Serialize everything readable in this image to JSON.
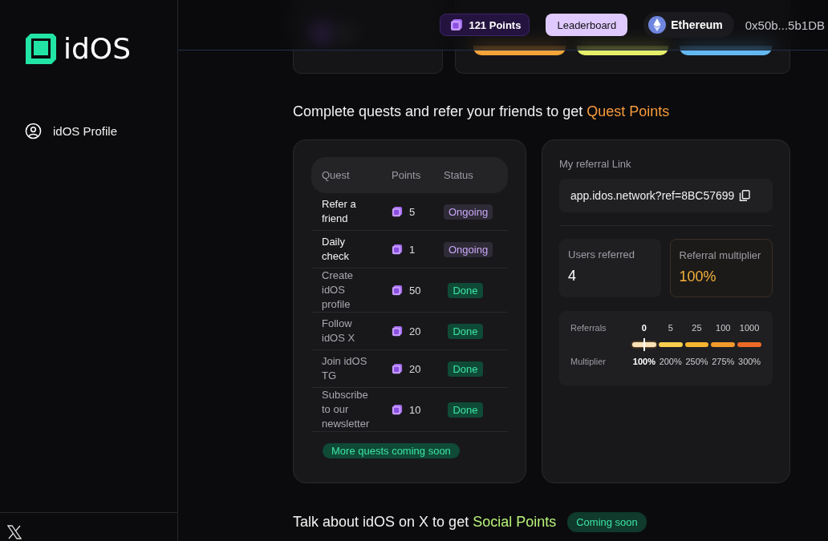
{
  "sidebar": {
    "logo": "idOS",
    "items": [
      {
        "label": "idOS Profile"
      }
    ]
  },
  "header": {
    "points": "121 Points",
    "leaderboard": "Leaderboard",
    "network": "Ethereum",
    "address": "0x50b...5b1DB"
  },
  "quests_section": {
    "heading": "Complete quests and refer your friends to get ",
    "highlight": "Quest Points",
    "columns": [
      "Quest",
      "Points",
      "Status"
    ],
    "rows": [
      {
        "name": "Refer a friend",
        "points": "5",
        "status": "Ongoing",
        "kind": "ongoing"
      },
      {
        "name": "Daily check",
        "points": "1",
        "status": "Ongoing",
        "kind": "ongoing"
      },
      {
        "name": "Create idOS profile",
        "points": "50",
        "status": "Done",
        "kind": "done"
      },
      {
        "name": "Follow idOS X",
        "points": "20",
        "status": "Done",
        "kind": "done"
      },
      {
        "name": "Join idOS TG",
        "points": "20",
        "status": "Done",
        "kind": "done"
      },
      {
        "name": "Subscribe to our newsletter",
        "points": "10",
        "status": "Done",
        "kind": "done"
      }
    ],
    "more": "More quests coming soon"
  },
  "referral": {
    "link_label": "My referral Link",
    "link": "app.idos.network?ref=8BC57699",
    "users_label": "Users referred",
    "users_value": "4",
    "multiplier_label": "Referral multiplier",
    "multiplier_value": "100%",
    "referrals_label": "Referrals",
    "multiplier_row_label": "Multiplier",
    "tiers": [
      {
        "referrals": "0",
        "multiplier": "100%",
        "color": "#fde2b8",
        "selected": true
      },
      {
        "referrals": "5",
        "multiplier": "200%",
        "color": "#fbcf4d",
        "selected": false
      },
      {
        "referrals": "25",
        "multiplier": "250%",
        "color": "#f8b531",
        "selected": false
      },
      {
        "referrals": "100",
        "multiplier": "275%",
        "color": "#f39a2c",
        "selected": false
      },
      {
        "referrals": "1000",
        "multiplier": "300%",
        "color": "#ec6a26",
        "selected": false
      }
    ]
  },
  "social_section": {
    "heading": "Talk about idOS on X to get ",
    "highlight": "Social Points",
    "badge": "Coming soon"
  }
}
